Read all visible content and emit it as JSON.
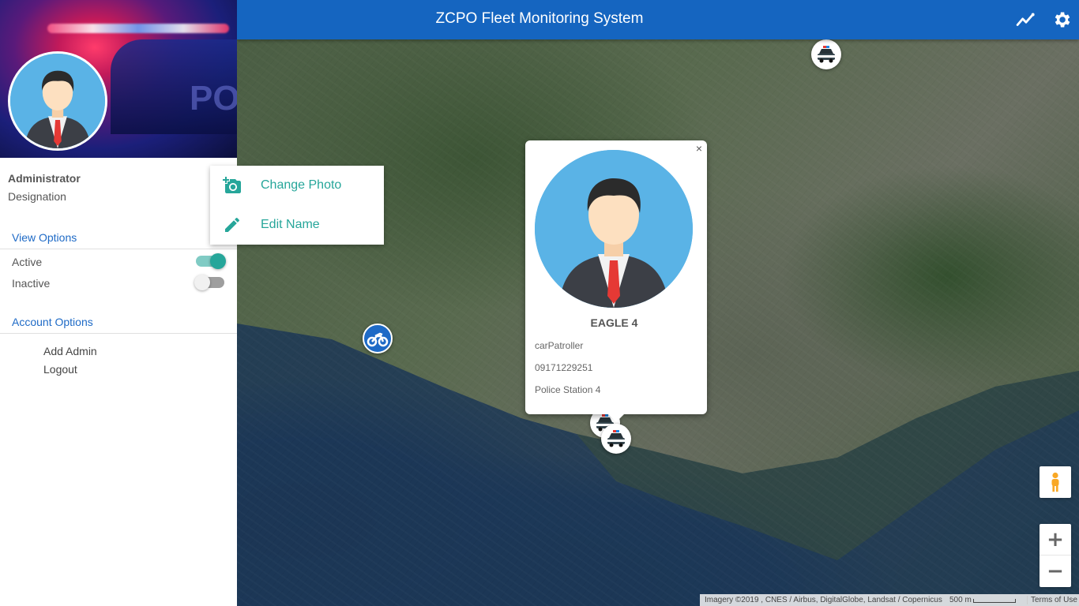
{
  "app": {
    "title": "ZCPO Fleet Monitoring System"
  },
  "topbar": {
    "icons": [
      "stats-icon",
      "gear-icon"
    ]
  },
  "sidebar": {
    "user": {
      "name": "Administrator",
      "designation": "Designation"
    },
    "view_options": {
      "title": "View Options",
      "items": [
        {
          "label": "Active",
          "on": true
        },
        {
          "label": "Inactive",
          "on": false
        }
      ]
    },
    "account_options": {
      "title": "Account Options",
      "items": [
        {
          "label": "Add Admin"
        },
        {
          "label": "Logout"
        }
      ]
    }
  },
  "context_menu": {
    "items": [
      {
        "label": "Change Photo",
        "icon": "add-photo-icon"
      },
      {
        "label": "Edit Name",
        "icon": "pencil-icon"
      }
    ]
  },
  "popup": {
    "close": "×",
    "name": "EAGLE 4",
    "role": "carPatroller",
    "phone": "09171229251",
    "station": "Police Station 4"
  },
  "map": {
    "zoom_in": "+",
    "zoom_out": "−",
    "attribution": "Imagery ©2019 , CNES / Airbus, DigitalGlobe, Landsat / Copernicus",
    "scale": "500 m",
    "terms": "Terms of Use"
  },
  "colors": {
    "topbar": "#1565c0",
    "accent": "#26a69a",
    "link": "#1e6ac6"
  }
}
